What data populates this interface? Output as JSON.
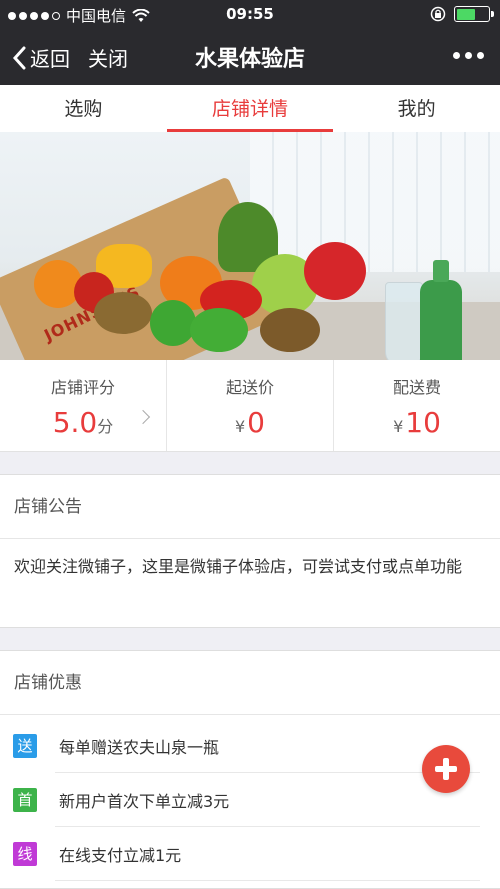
{
  "status_bar": {
    "carrier": "中国电信",
    "time": "09:55",
    "signal_icon": "signal-dots-icon",
    "wifi_icon": "wifi-icon",
    "lock_icon": "rotation-lock-icon",
    "battery_icon": "battery-icon",
    "battery_color": "#4cd964",
    "battery_level": 0.6
  },
  "nav": {
    "back_label": "返回",
    "close_label": "关闭",
    "title": "水果体验店",
    "more_icon": "more-dots-icon"
  },
  "tabs": [
    {
      "label": "选购",
      "active": false
    },
    {
      "label": "店铺详情",
      "active": true
    },
    {
      "label": "我的",
      "active": false
    }
  ],
  "banner": {
    "bag_text": "JOHNSONS",
    "page_count": 4,
    "active_page": 4,
    "accent_color": "#22a7e8"
  },
  "stats": {
    "rating": {
      "label": "店铺评分",
      "value": "5.0",
      "unit": "分"
    },
    "min_order": {
      "label": "起送价",
      "currency": "¥",
      "value": "0"
    },
    "delivery_fee": {
      "label": "配送费",
      "currency": "¥",
      "value": "10"
    }
  },
  "notice": {
    "title": "店铺公告",
    "text": "欢迎关注微铺子，这里是微铺子体验店，可尝试支付或点单功能"
  },
  "promotions": {
    "title": "店铺优惠",
    "items": [
      {
        "badge": "送",
        "text": "每单赠送农夫山泉一瓶",
        "color": "#2a9ce8"
      },
      {
        "badge": "首",
        "text": "新用户首次下单立减3元",
        "color": "#3db34a"
      },
      {
        "badge": "线",
        "text": "在线支付立减1元",
        "color": "#c03ad6"
      }
    ]
  },
  "fab": {
    "icon": "plus-icon",
    "color": "#e84a3c"
  },
  "accent_color": "#e83c3c"
}
